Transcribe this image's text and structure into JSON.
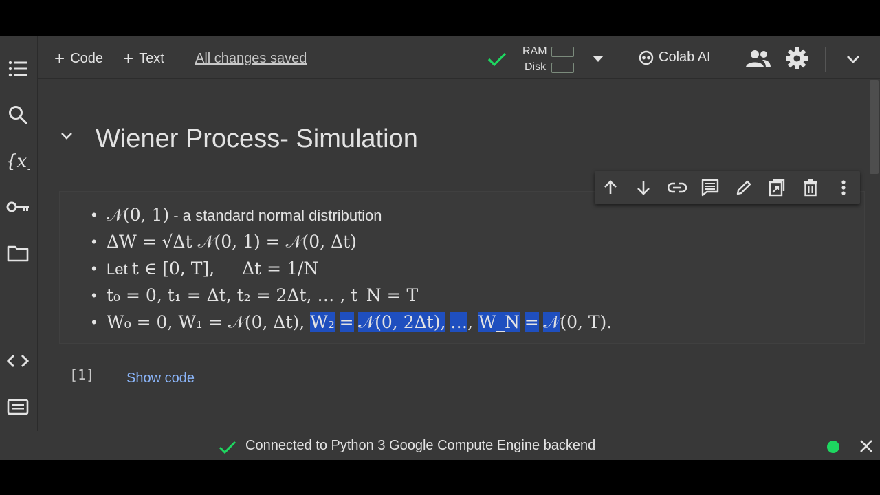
{
  "toolbar": {
    "add_code_label": "Code",
    "add_text_label": "Text",
    "save_status": "All changes saved",
    "ram_label": "RAM",
    "disk_label": "Disk",
    "colab_ai_label": "Colab AI"
  },
  "notebook": {
    "section_title": "Wiener Process- Simulation",
    "bullets": {
      "b1_math": "𝒩(0, 1)",
      "b1_text": " - a standard normal distribution",
      "b2_math": "ΔW = √Δt 𝒩(0, 1) = 𝒩(0, Δt)",
      "b3_text": "Let ",
      "b3_math": "t ∈ [0, T],",
      "b3_math2": "Δt = 1/N",
      "b4_math": "t₀ = 0, t₁ = Δt, t₂ = 2Δt, … , t_N = T",
      "b5_math_plain": "W₀ = 0, W₁ = 𝒩(0, Δt), ",
      "b5_sel1": "W₂",
      "b5_sel2": "=",
      "b5_sel3": "𝒩(0, 2Δt),",
      "b5_sel4": "…",
      "b5_comma": ", ",
      "b5_sel5": "W_N",
      "b5_sel6": "=",
      "b5_sel7": "𝒩",
      "b5_tail": "(0, T)."
    },
    "code_cell_number": "[1]",
    "show_code_label": "Show code"
  },
  "status_bar": {
    "message": "Connected to Python 3 Google Compute Engine backend"
  },
  "colors": {
    "background": "#383838",
    "accent_green": "#1ed760",
    "link_blue": "#8ab4f8",
    "selection_blue": "#1f4fbf"
  },
  "icons": [
    "menu-icon",
    "search-icon",
    "variables-icon",
    "key-icon",
    "folder-icon",
    "code-snippets-icon",
    "terminal-icon",
    "check-icon",
    "chevron-down-icon",
    "colab-ai-icon",
    "people-icon",
    "gear-icon",
    "arrow-up-icon",
    "arrow-down-icon",
    "link-icon",
    "comment-icon",
    "pencil-icon",
    "mirror-cell-icon",
    "trash-icon",
    "more-vert-icon",
    "close-icon"
  ]
}
